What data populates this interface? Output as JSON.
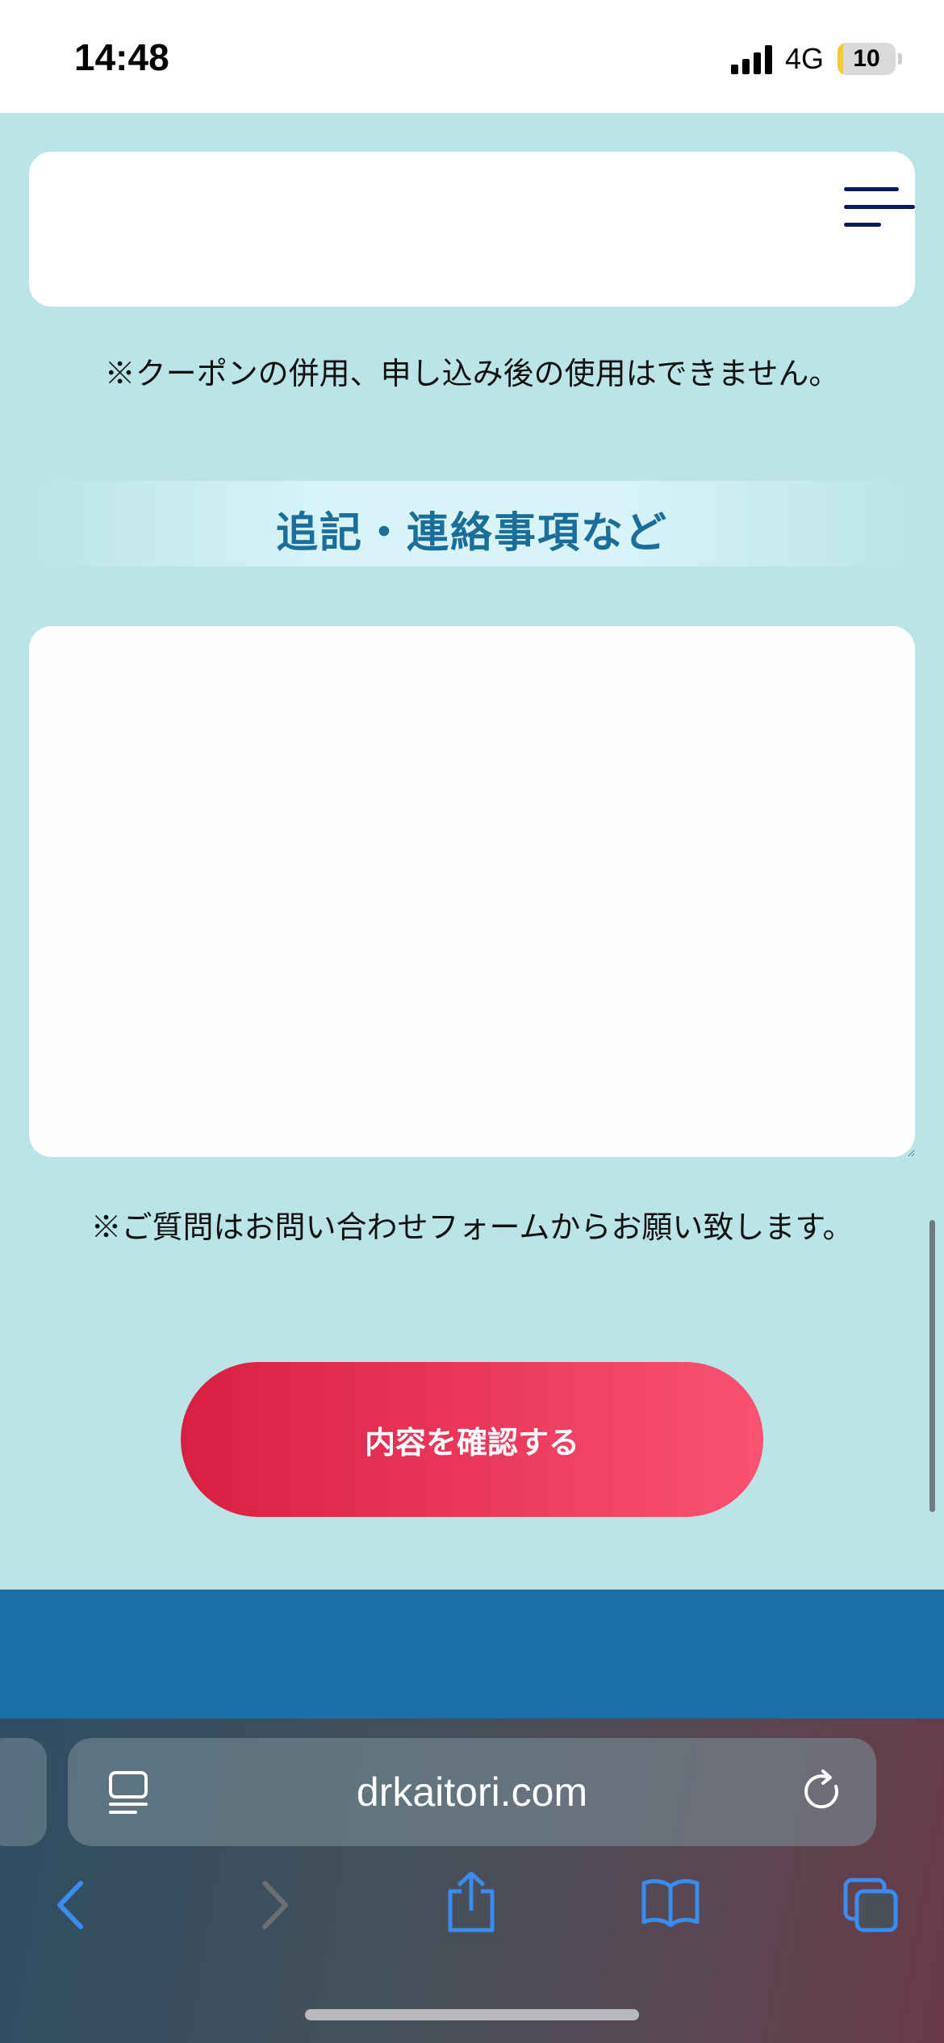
{
  "status_bar": {
    "time": "14:48",
    "network": "4G",
    "battery": "10",
    "battery_level": 0.1
  },
  "notes": {
    "coupon_note": "※クーポンの併用、申し込み後の使用はできません。",
    "question_note": "※ご質問はお問い合わせフォームからお願い致します。"
  },
  "section": {
    "title": "追記・連絡事項など"
  },
  "form": {
    "textarea_value": "",
    "submit_label": "内容を確認する"
  },
  "browser": {
    "url": "drkaitori.com"
  },
  "icons": {
    "menu": "hamburger-icon",
    "reader": "reader-mode-icon",
    "reload": "reload-icon",
    "back": "chevron-left-icon",
    "forward": "chevron-right-icon",
    "share": "share-icon",
    "bookmarks": "book-icon",
    "tabs": "tabs-icon"
  },
  "colors": {
    "page_bg": "#bae4e8",
    "accent_title": "#1b6e99",
    "button_start": "#d91f42",
    "button_end": "#fa5273",
    "footer": "#1a6fa4",
    "safari_icon": "#3a8cf0"
  }
}
